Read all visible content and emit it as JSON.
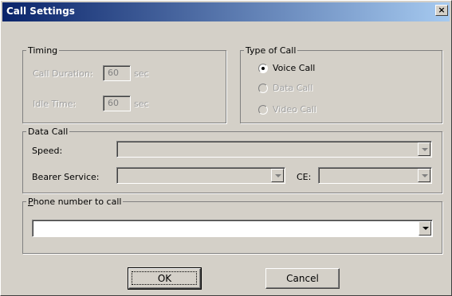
{
  "window": {
    "title": "Call Settings",
    "close_glyph": "×",
    "close_icon": "close-icon"
  },
  "timing": {
    "legend": "Timing",
    "call_duration_label": "Call Duration:",
    "call_duration_value": "60",
    "call_duration_unit": "sec",
    "idle_time_label": "Idle Time:",
    "idle_time_value": "60",
    "idle_time_unit": "sec"
  },
  "type_of_call": {
    "legend": "Type of Call",
    "options": [
      {
        "label": "Voice Call",
        "selected": true,
        "enabled": true
      },
      {
        "label": "Data Call",
        "selected": false,
        "enabled": false
      },
      {
        "label": "Video Call",
        "selected": false,
        "enabled": false
      }
    ]
  },
  "data_call": {
    "legend": "Data Call",
    "speed_label": "Speed:",
    "speed_value": "",
    "bearer_label": "Bearer Service:",
    "bearer_value": "",
    "ce_label": "CE:",
    "ce_value": ""
  },
  "phone": {
    "legend_prefix": "P",
    "legend_rest": "hone number to call",
    "value": ""
  },
  "buttons": {
    "ok": "OK",
    "cancel": "Cancel"
  },
  "colors": {
    "title_start": "#0a246a",
    "title_end": "#a6caf0",
    "face": "#d4d0c8"
  }
}
